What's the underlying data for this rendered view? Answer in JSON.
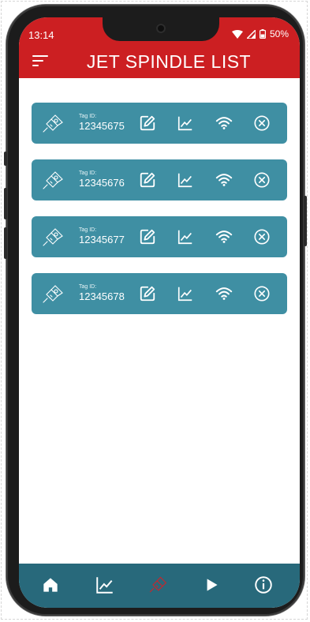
{
  "status_bar": {
    "time": "13:14",
    "battery": "50%"
  },
  "header": {
    "title": "JET SPINDLE LIST"
  },
  "spindles": [
    {
      "tag_label": "Tag ID:",
      "tag_id": "12345675"
    },
    {
      "tag_label": "Tag ID:",
      "tag_id": "12345676"
    },
    {
      "tag_label": "Tag ID:",
      "tag_id": "12345677"
    },
    {
      "tag_label": "Tag ID:",
      "tag_id": "12345678"
    }
  ],
  "actions": [
    "edit-icon",
    "line-chart-icon",
    "wifi-icon",
    "close-circle-icon"
  ],
  "bottom_nav": [
    "home-icon",
    "line-chart-icon",
    "spindle-icon",
    "play-icon",
    "info-icon"
  ],
  "colors": {
    "header_red": "#cc1f22",
    "card_teal": "#3f8fa3",
    "nav_teal": "#28697b",
    "active_nav": "#c7262c"
  }
}
